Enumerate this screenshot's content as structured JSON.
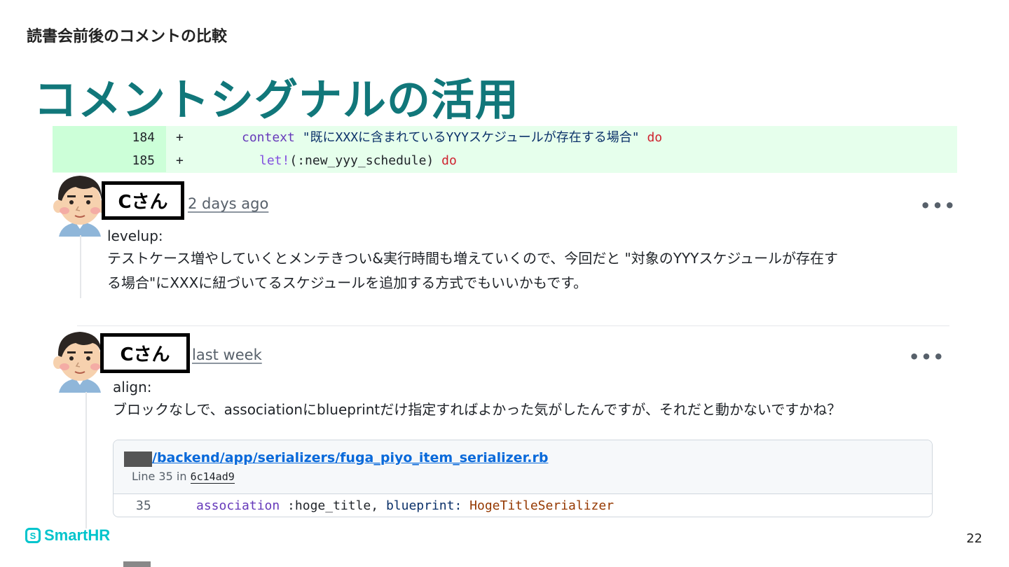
{
  "slide": {
    "subtitle": "読書会前後のコメントの比較",
    "title": "コメントシグナルの活用",
    "page_number": "22",
    "brand": "SmartHR",
    "brand_mark": "S"
  },
  "diff": {
    "rows": [
      {
        "line": "184",
        "sign": "+",
        "kw": "context",
        "str": "\"既にXXXに含まれているYYYスケジュールが存在する場合\"",
        "tail": "do"
      },
      {
        "line": "185",
        "sign": "+",
        "kw": "let!",
        "str": "(:new_yyy_schedule)",
        "tail": "do"
      }
    ]
  },
  "comments": [
    {
      "author": "Cさん",
      "time": "2 days ago",
      "menu": "•••",
      "label": "levelup:",
      "body_line1": "テストケース増やしていくとメンテきつい&実行時間も増えていくので、今回だと \"対象のYYYスケジュールが存在す",
      "body_line2": "る場合\"にXXXに紐づいてるスケジュールを追加する方式でもいいかもです。"
    },
    {
      "author": "Cさん",
      "time": "last week",
      "menu": "•••",
      "label": "align:",
      "body_line1": "ブロックなしで、associationにblueprintだけ指定すればよかった気がしたんですが、それだと動かないですかね？"
    }
  ],
  "code_ref": {
    "path": "/backend/app/serializers/fuga_piyo_item_serializer.rb",
    "line_prefix": "Line 35 in",
    "sha": "6c14ad9",
    "line_no": "35",
    "code_kw": "association",
    "code_mid": " :hoge_title, ",
    "code_kw2": "blueprint:",
    "code_cls": " HogeTitleSerializer"
  },
  "colors": {
    "title": "#11777a",
    "diff_bg": "#e6ffec",
    "diff_num_bg": "#ccffd8",
    "link": "#0969da",
    "brand": "#00c4cc"
  }
}
